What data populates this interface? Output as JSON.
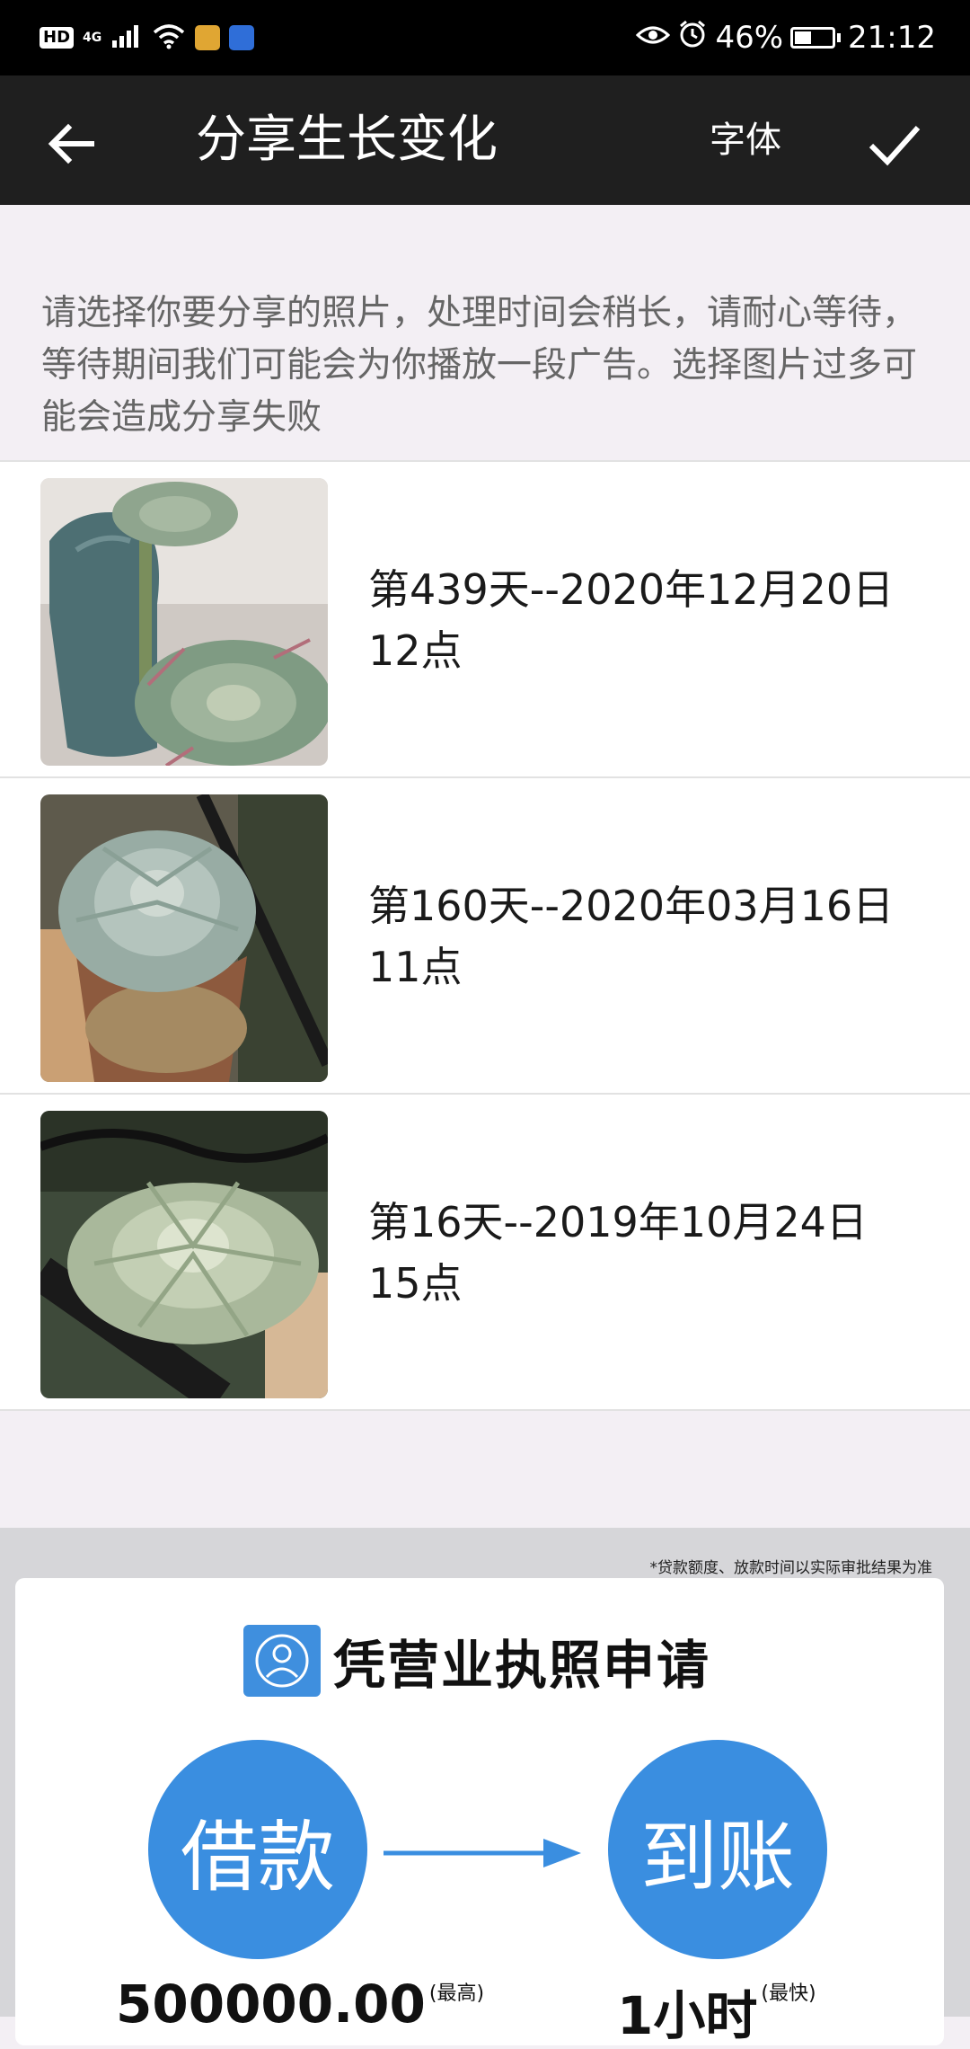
{
  "status_bar": {
    "network": "4G",
    "hd": "HD",
    "battery": "46%",
    "time": "21:12",
    "battery_level": 0.46
  },
  "toolbar": {
    "back_icon": "arrow-left-icon",
    "title": "分享生长变化",
    "font_label": "字体",
    "confirm_icon": "check-icon"
  },
  "notice": "请选择你要分享的照片，处理时间会稍长，请耐心等待，等待期间我们可能会为你播放一段广告。选择图片过多可能会造成分享失败",
  "photos": [
    {
      "label_line1": "第439天--2020年12月20日",
      "label_line2": "12点"
    },
    {
      "label_line1": "第160天--2020年03月16日",
      "label_line2": "11点"
    },
    {
      "label_line1": "第16天--2019年10月24日",
      "label_line2": "15点"
    }
  ],
  "ad": {
    "note": "*贷款额度、放款时间以实际审批结果为准",
    "title": "凭营业执照申请",
    "left_circle": "借款",
    "right_circle": "到账",
    "amount": "500000.00",
    "amount_sup": "(最高)",
    "time": "1小时",
    "time_sup": "(最快)"
  },
  "colors": {
    "toolbar_bg": "#1f1f1f",
    "page_bg": "#f3eff4",
    "ad_blue": "#3a8ee0"
  }
}
